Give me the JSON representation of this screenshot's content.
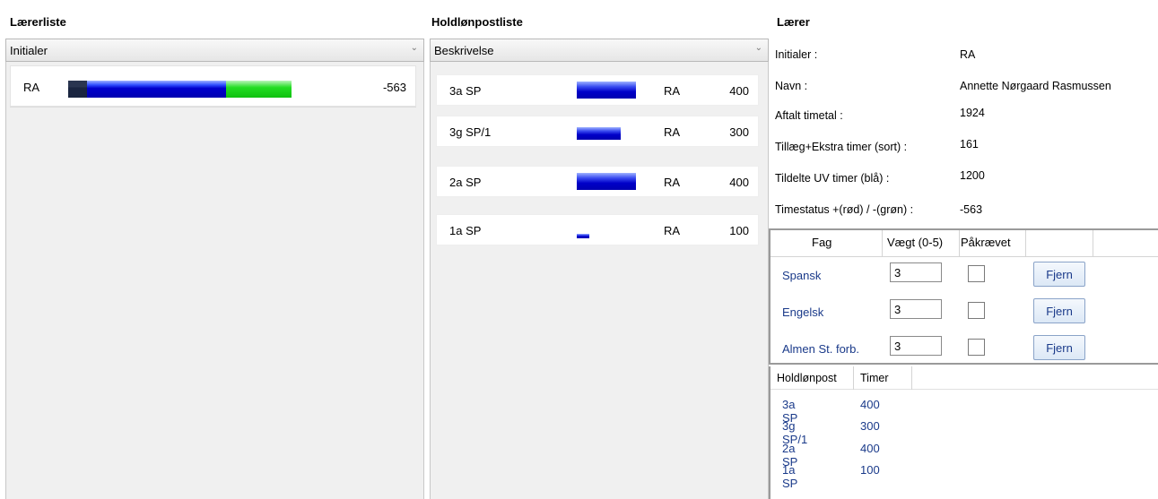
{
  "panels": {
    "teachers": {
      "title": "Lærerliste",
      "column_header": "Initialer"
    },
    "holdlon": {
      "title": "Holdlønpostliste",
      "column_header": "Beskrivelse"
    },
    "teacher": {
      "title": "Lærer"
    }
  },
  "teacher_list": [
    {
      "initials": "RA",
      "status": "-563",
      "bar": {
        "agreed": 1924,
        "extra": 161,
        "assigned_uv": 1200,
        "status": -563
      }
    }
  ],
  "holdlon_list": [
    {
      "label": "3a SP",
      "teacher": "RA",
      "hours": "400",
      "fill": 1.0
    },
    {
      "label": "3g SP/1",
      "teacher": "RA",
      "hours": "300",
      "fill": 0.75
    },
    {
      "label": "2a SP",
      "teacher": "RA",
      "hours": "400",
      "fill": 1.0
    },
    {
      "label": "1a SP",
      "teacher": "RA",
      "hours": "100",
      "fill": 0.25
    }
  ],
  "teacher_detail": {
    "initials_label": "Initialer :",
    "initials_value": "RA",
    "name_label": "Navn :",
    "name_value": "Annette Nørgaard Rasmussen",
    "agreed_label": "Aftalt timetal :",
    "agreed_value": "1924",
    "extra_label": "Tillæg+Ekstra timer (sort) :",
    "extra_value": "161",
    "assigned_label": "Tildelte UV timer (blå) :",
    "assigned_value": "1200",
    "status_label": "Timestatus +(rød) / -(grøn) :",
    "status_value": "-563"
  },
  "fag_table": {
    "headers": {
      "fag": "Fag",
      "weight": "Vægt (0-5)",
      "required": "Påkrævet"
    },
    "remove_label": "Fjern",
    "rows": [
      {
        "name": "Spansk",
        "weight": "3",
        "required": false
      },
      {
        "name": "Engelsk",
        "weight": "3",
        "required": false
      },
      {
        "name": "Almen St. forb.",
        "weight": "3",
        "required": false
      }
    ]
  },
  "holdlon_table": {
    "headers": {
      "post": "Holdlønpost",
      "hours": "Timer"
    },
    "rows": [
      {
        "post": "3a SP",
        "hours": "400"
      },
      {
        "post": "3g SP/1",
        "hours": "300"
      },
      {
        "post": "2a SP",
        "hours": "400"
      },
      {
        "post": "1a SP",
        "hours": "100"
      }
    ]
  },
  "colors": {
    "extra": "#2a3550",
    "assigned": "#0000cc",
    "status_negative": "#22dd22",
    "status_positive": "#dd2222"
  }
}
